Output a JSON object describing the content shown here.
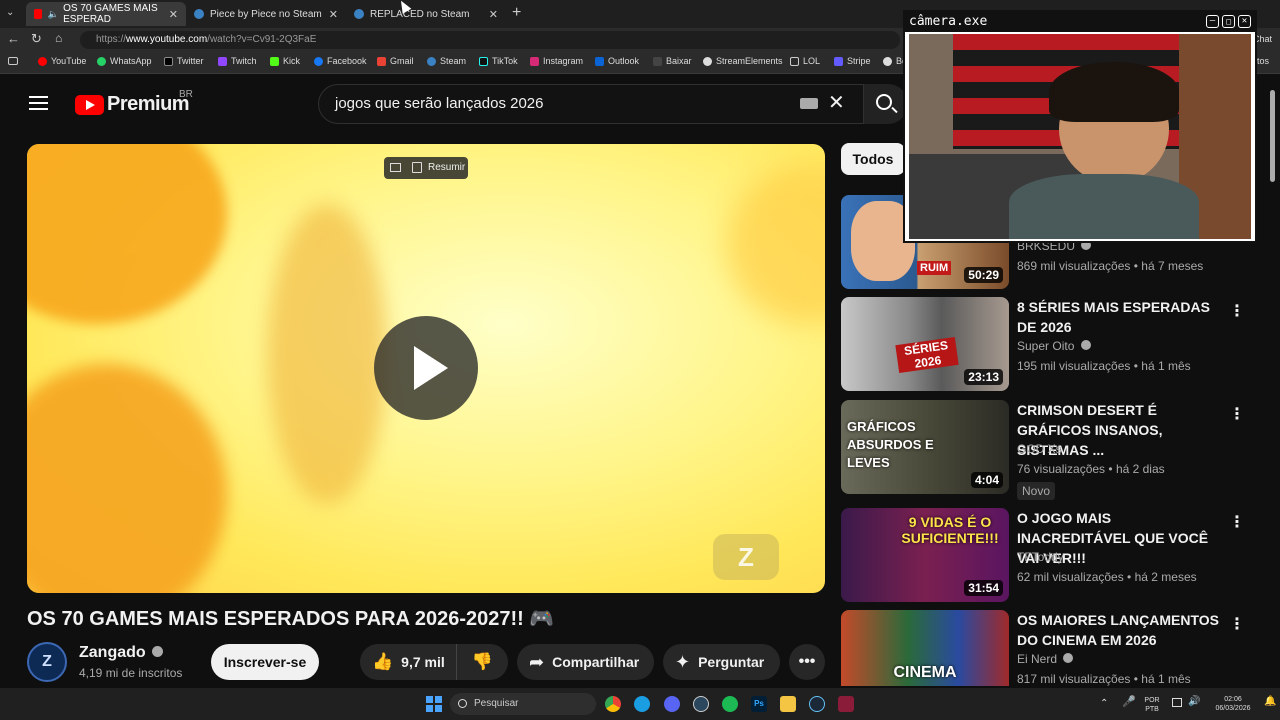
{
  "browser": {
    "tabs": [
      {
        "label": "OS 70 GAMES MAIS ESPERAD",
        "active": true
      },
      {
        "label": "Piece by Piece no Steam",
        "active": false
      },
      {
        "label": "REPLACED no Steam",
        "active": false
      }
    ],
    "url_prefix": "https://",
    "url_host": "www.youtube.com",
    "url_path": "/watch?v=Cv91-2Q3FaE",
    "right_label": "Chat",
    "bookmarks": [
      "YouTube",
      "WhatsApp",
      "Twitter",
      "Twitch",
      "Kick",
      "Facebook",
      "Gmail",
      "Steam",
      "TikTok",
      "Instagram",
      "Outlook",
      "Baixar",
      "StreamElements",
      "LOL",
      "Stripe",
      "Bot"
    ],
    "bookmarks_end": "itos"
  },
  "header": {
    "logo_text": "Premium",
    "region": "BR",
    "search_value": "jogos que serão lançados 2026"
  },
  "video": {
    "summarize_label": "Resumir",
    "title": "OS 70 GAMES MAIS ESPERADOS PARA 2026-2027!!",
    "channel": "Zangado",
    "subscribers": "4,19 mi de inscritos",
    "subscribe_label": "Inscrever-se",
    "likes": "9,7 mil",
    "share_label": "Compartilhar",
    "ask_label": "Perguntar"
  },
  "sidebar": {
    "chip_all": "Todos",
    "recommendations": [
      {
        "title": "",
        "channel": "BRKSEDU",
        "views": "869 mil visualizações",
        "age": "há 7 meses",
        "duration": "50:29",
        "thumb_text": "RUIM"
      },
      {
        "title": "8 SÉRIES MAIS ESPERADAS DE 2026",
        "channel": "Super Oito",
        "views": "195 mil visualizações",
        "age": "há 1 mês",
        "duration": "23:13",
        "thumb_text": "SÉRIES 2026"
      },
      {
        "title": "CRIMSON DESERT É GRÁFICOS INSANOS, SISTEMAS ...",
        "channel": "GOD Xs",
        "views": "76 visualizações",
        "age": "há 2 dias",
        "duration": "4:04",
        "badge": "Novo",
        "thumb_text": "GRÁFICOS ABSURDOS E LEVES"
      },
      {
        "title": "O JOGO MAIS INACREDITÁVEL QUE VOCÊ VAI VER!!!",
        "channel": "TFToddy",
        "views": "62 mil visualizações",
        "age": "há 2 meses",
        "duration": "31:54",
        "thumb_text": "9 VIDAS É O SUFICIENTE!!!"
      },
      {
        "title": "OS MAIORES LANÇAMENTOS DO CINEMA EM 2026",
        "channel": "Ei Nerd",
        "views": "817 mil visualizações",
        "age": "há 1 mês",
        "duration": "",
        "thumb_text": "CINEMA"
      }
    ]
  },
  "camera": {
    "window_title": "câmera.exe"
  },
  "taskbar": {
    "search_placeholder": "Pesquisar",
    "lang_1": "POR",
    "lang_2": "PTB",
    "time": "02:06",
    "date": "06/03/2026"
  },
  "colors": {
    "yt_red": "#ff0000",
    "background": "#0f0f0f",
    "video_yellow": "#fff58a"
  }
}
